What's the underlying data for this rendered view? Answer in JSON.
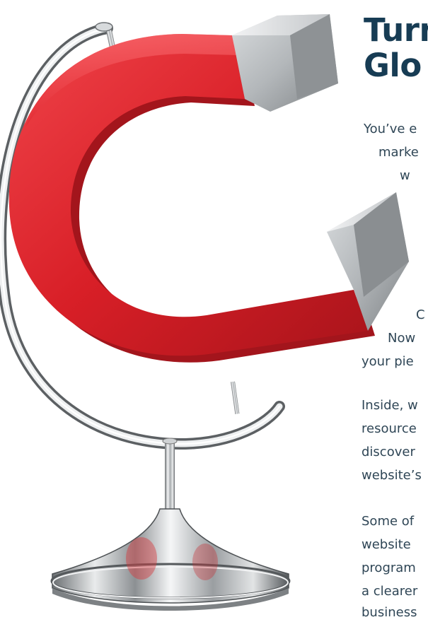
{
  "heading": {
    "line1": "Turn",
    "line2": "Glo"
  },
  "body_lines": [
    "You’ve e",
    "marke",
    "w",
    "C",
    "Now",
    "your pie",
    "Inside, w",
    "resource",
    "discover",
    "website’s",
    "Some of",
    "website",
    "program",
    "a clearer",
    "business"
  ],
  "illustration": {
    "subject": "red-horseshoe-magnet-on-chrome-globe-stand",
    "colors": {
      "magnet_red": "#e0242c",
      "magnet_tip": "#b8bcbf",
      "chrome": "#c9ccce",
      "heading_navy": "#173c54"
    }
  }
}
